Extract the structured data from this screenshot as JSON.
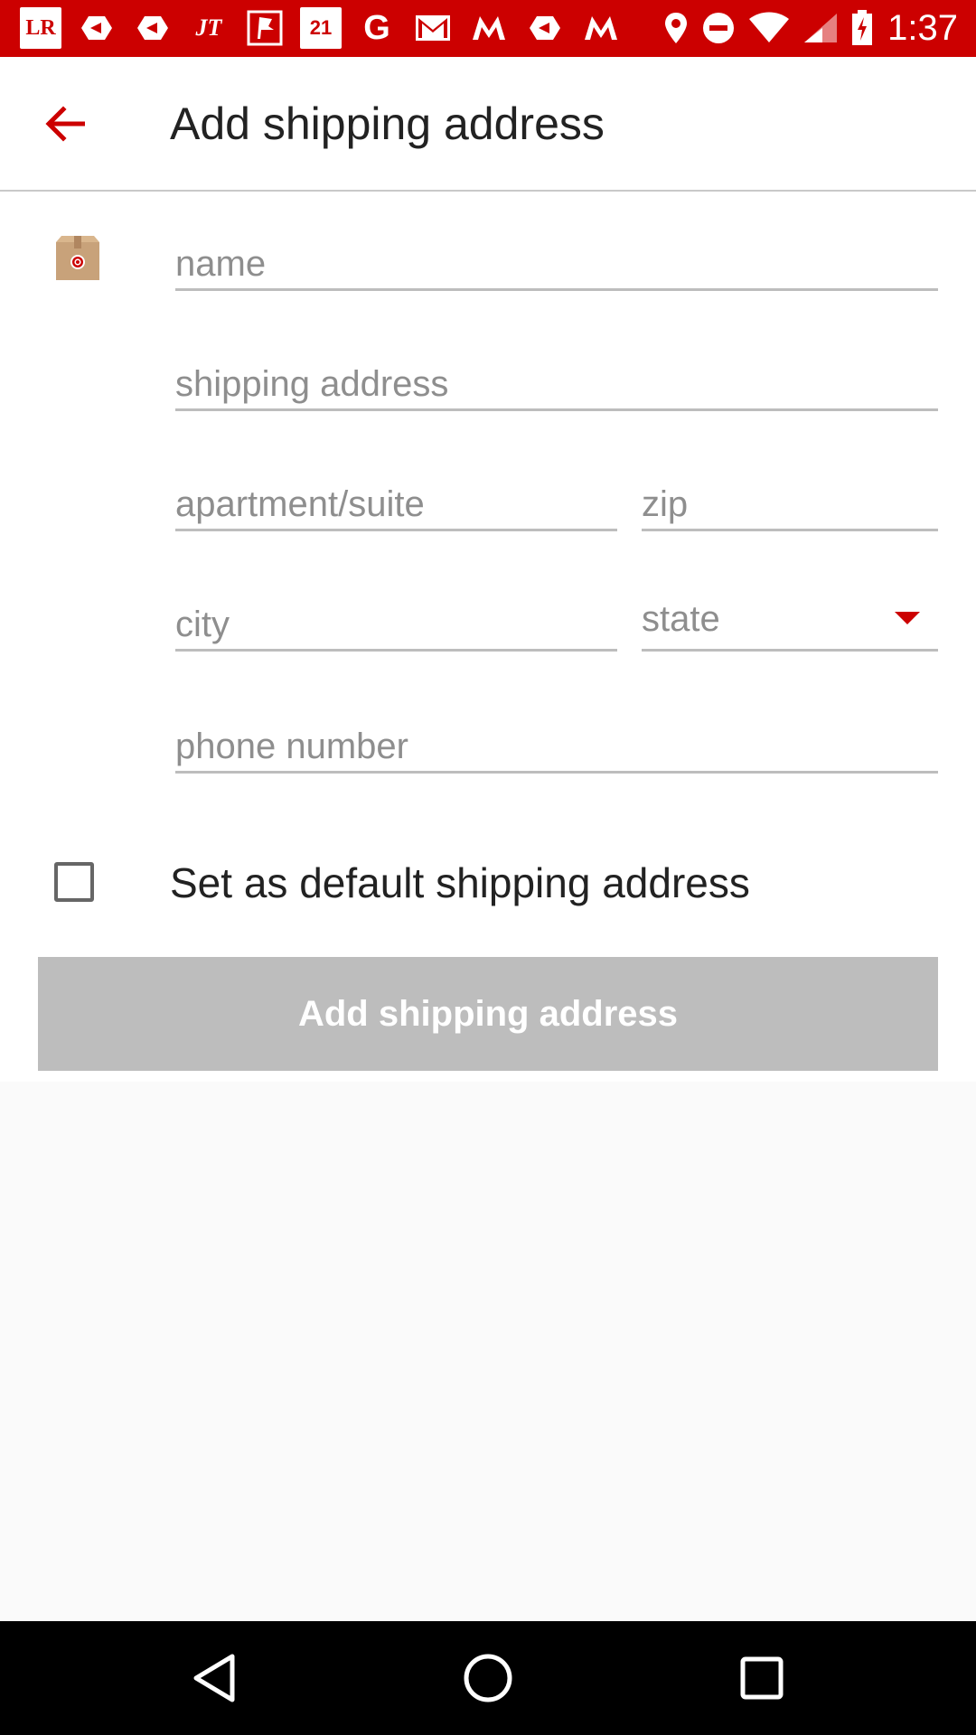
{
  "status_bar": {
    "time": "1:37",
    "left_icons": [
      "LR",
      "slides-icon",
      "slides-icon",
      "JT",
      "flag-icon",
      "21",
      "google-icon",
      "gmail-icon",
      "maps-icon",
      "slides-icon",
      "maps-icon"
    ],
    "lr_label": "LR",
    "jt_label": "JT",
    "calendar_label": "21",
    "g_label": "G",
    "accent": "#cc0000"
  },
  "app_bar": {
    "title": "Add shipping address"
  },
  "form": {
    "name_placeholder": "name",
    "address_placeholder": "shipping address",
    "apartment_placeholder": "apartment/suite",
    "zip_placeholder": "zip",
    "city_placeholder": "city",
    "state_label": "state",
    "phone_placeholder": "phone number",
    "default_checkbox_label": "Set as default shipping address",
    "default_checked": false,
    "submit_label": "Add shipping address"
  },
  "colors": {
    "brand_red": "#cc0000",
    "disabled_button": "#bdbdbd",
    "underline": "#bdbdbd"
  }
}
